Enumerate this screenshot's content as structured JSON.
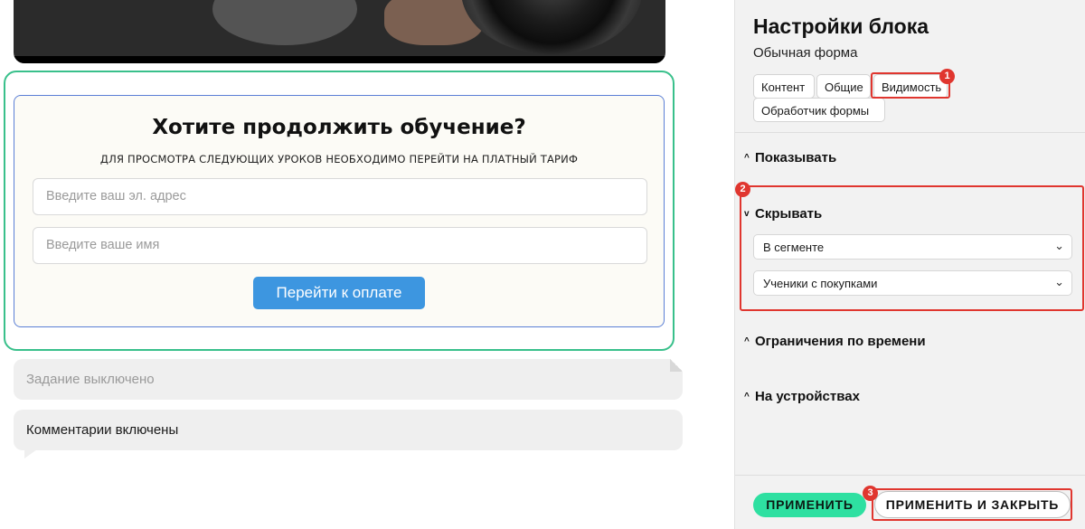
{
  "left": {
    "form": {
      "title": "Хотите продолжить обучение?",
      "subtitle": "ДЛЯ ПРОСМОТРА СЛЕДУЮЩИХ УРОКОВ НЕОБХОДИМО ПЕРЕЙТИ НА ПЛАТНЫЙ ТАРИФ",
      "email_placeholder": "Введите ваш эл. адрес",
      "name_placeholder": "Введите ваше имя",
      "submit_label": "Перейти к оплате"
    },
    "task_status": "Задание выключено",
    "comments_status": "Комментарии включены"
  },
  "panel": {
    "title": "Настройки блока",
    "subtitle": "Обычная форма",
    "tabs": [
      {
        "label": "Контент"
      },
      {
        "label": "Общие"
      },
      {
        "label": "Видимость"
      },
      {
        "label": "Обработчик формы"
      }
    ],
    "sections": {
      "show": "Показывать",
      "hide": "Скрывать",
      "time": "Ограничения по времени",
      "devices": "На устройствах"
    },
    "hide_selects": {
      "condition": "В сегменте",
      "segment": "Ученики с покупками"
    },
    "apply_label": "ПРИМЕНИТЬ",
    "apply_close_label": "ПРИМЕНИТЬ И ЗАКРЫТЬ"
  },
  "annotations": {
    "badge1": "1",
    "badge2": "2",
    "badge3": "3"
  },
  "colors": {
    "accent_green": "#2ee0a1",
    "highlight_red": "#e0362f",
    "button_blue": "#3d96e0",
    "selection_green": "#39c08b"
  }
}
